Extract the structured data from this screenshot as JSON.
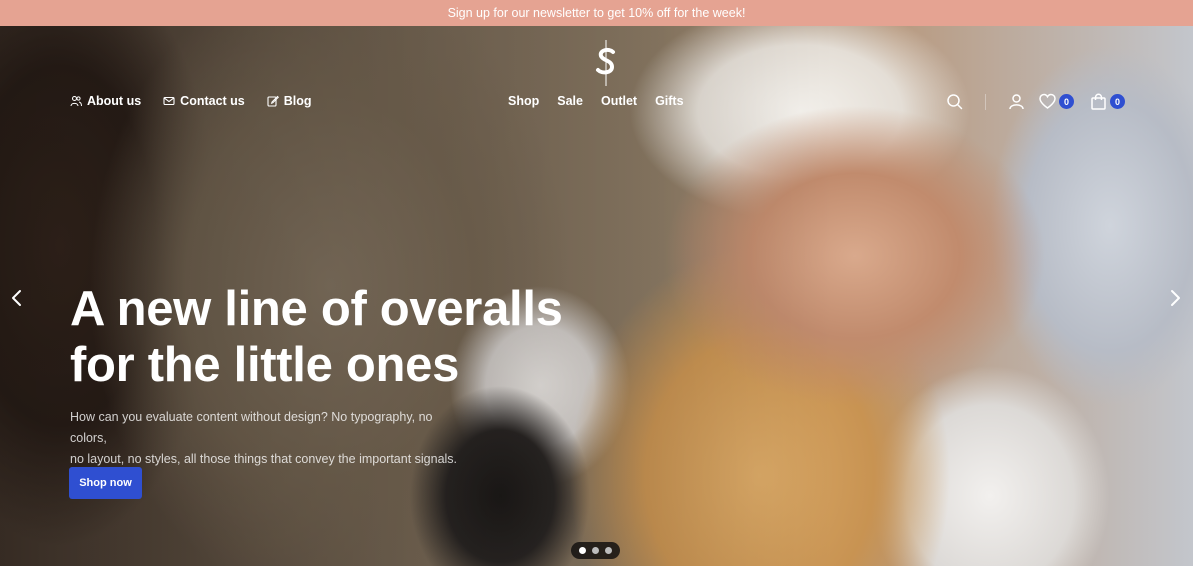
{
  "promo": {
    "text": "Sign up for our newsletter to get 10% off for the week!"
  },
  "header": {
    "left_links": [
      {
        "label": "About us",
        "icon": "users-icon"
      },
      {
        "label": "Contact us",
        "icon": "mail-icon"
      },
      {
        "label": "Blog",
        "icon": "edit-icon"
      }
    ],
    "center_links": [
      "Shop",
      "Sale",
      "Outlet",
      "Gifts"
    ],
    "wishlist_count": "0",
    "cart_count": "0"
  },
  "hero": {
    "headline_line1": "A new line of overalls",
    "headline_line2": "for the little ones",
    "subtext_line1": "How can you evaluate content without design? No typography, no colors,",
    "subtext_line2": "no layout, no styles, all those things that convey the important signals.",
    "cta_label": "Shop now",
    "slide_count": 3,
    "active_slide": 1
  },
  "colors": {
    "promo_bg": "#e5a392",
    "accent": "#2f4fd1"
  }
}
